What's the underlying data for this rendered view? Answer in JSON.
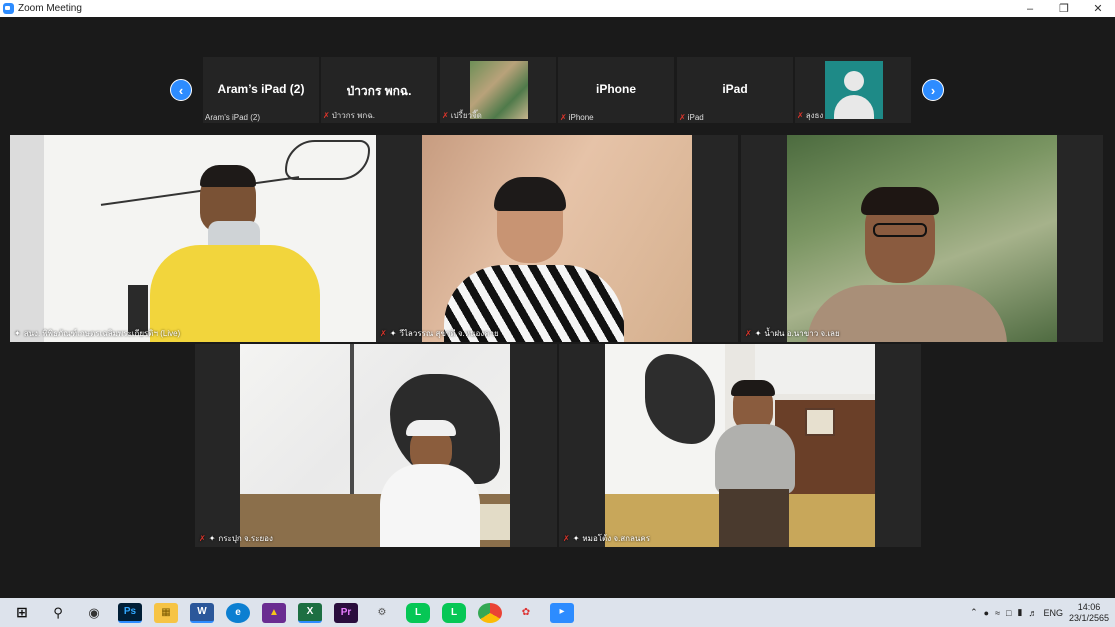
{
  "window": {
    "title": "Zoom Meeting"
  },
  "strip": {
    "thumbs": [
      {
        "big": "Aram’s iPad (2)",
        "caption": "Aram’s iPad (2)",
        "muted": false,
        "kind": "name"
      },
      {
        "big": "ป่าวกร พกฉ.",
        "caption": "ป่าวกร พกฉ.",
        "muted": true,
        "kind": "name"
      },
      {
        "big": "",
        "caption": "เปรี้ยวจี๊ด",
        "muted": true,
        "kind": "photo"
      },
      {
        "big": "iPhone",
        "caption": "iPhone",
        "muted": true,
        "kind": "name"
      },
      {
        "big": "iPad",
        "caption": "iPad",
        "muted": true,
        "kind": "name"
      },
      {
        "big": "",
        "caption": "ลุงธง",
        "muted": true,
        "kind": "avatar"
      }
    ]
  },
  "tiles": [
    {
      "label": "สนง. พิพิธภัณฑ์เกษตรเฉลิมพระเกียรติฯ (Live)",
      "muted": false
    },
    {
      "label": "วีไลวรรณ สุขาดี จ.หนองคาย",
      "muted": true
    },
    {
      "label": "น้ำฝน อ.นาขาว จ.เลย",
      "muted": true
    },
    {
      "label": "กระปุก จ.ระยอง",
      "muted": true
    },
    {
      "label": "หมอโต้ง จ.สกลนคร",
      "muted": true
    }
  ],
  "taskbar": {
    "lang": "ENG",
    "time": "14:06",
    "date": "23/1/2565"
  }
}
